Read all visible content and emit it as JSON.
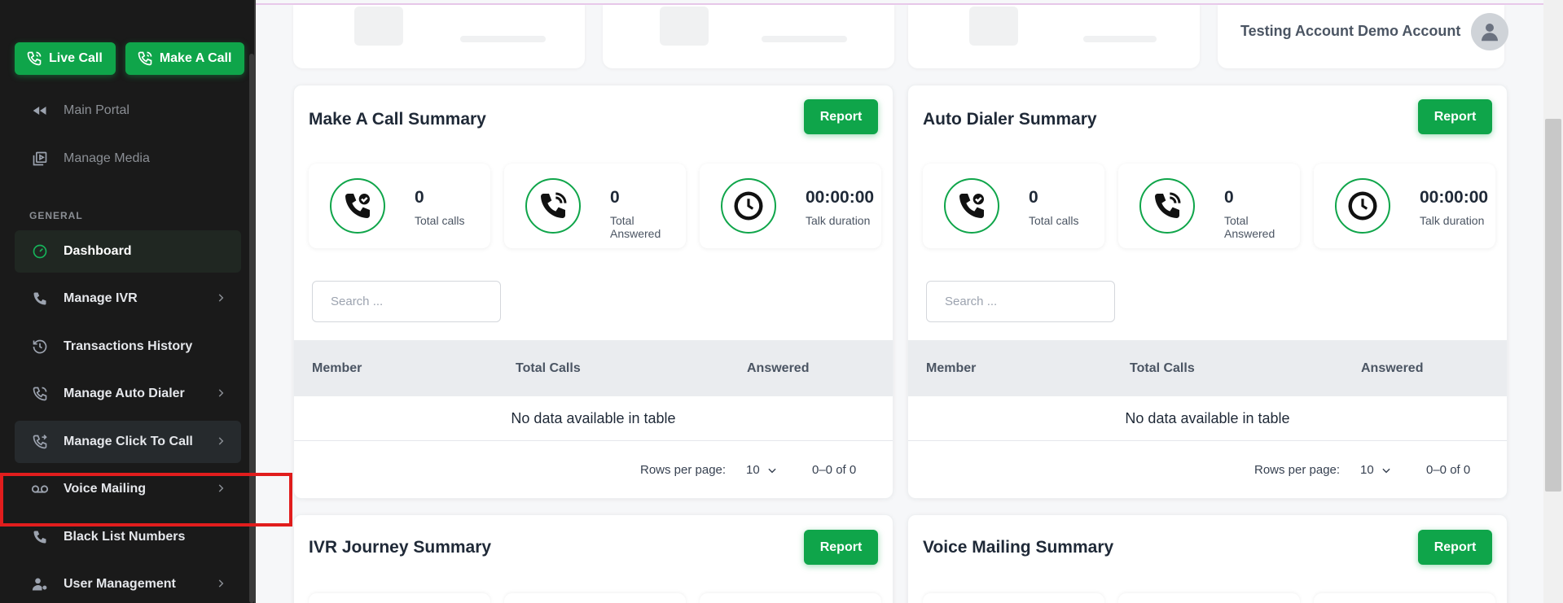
{
  "sidebar": {
    "live_call": "Live Call",
    "make_call": "Make A Call",
    "items_top": [
      {
        "label": "Main Portal",
        "icon": "rewind-icon"
      },
      {
        "label": "Manage Media",
        "icon": "media-icon"
      }
    ],
    "section_general": "GENERAL",
    "items": [
      {
        "label": "Dashboard",
        "icon": "gauge-icon"
      },
      {
        "label": "Manage IVR",
        "icon": "phone-icon"
      },
      {
        "label": "Transactions History",
        "icon": "history-icon"
      },
      {
        "label": "Manage Auto Dialer",
        "icon": "phone-dial-icon"
      },
      {
        "label": "Manage Click To Call",
        "icon": "phone-forward-icon"
      },
      {
        "label": "Voice Mailing",
        "icon": "voicemail-icon"
      },
      {
        "label": "Black List Numbers",
        "icon": "phone-icon"
      },
      {
        "label": "User Management",
        "icon": "user-cog-icon"
      }
    ]
  },
  "header": {
    "user_name": "Testing Account Demo Account"
  },
  "panels": {
    "make_call": {
      "title": "Make A Call Summary",
      "report": "Report",
      "stats": [
        {
          "value": "0",
          "label": "Total calls"
        },
        {
          "value": "0",
          "label": "Total Answered"
        },
        {
          "value": "00:00:00",
          "label": "Talk duration"
        }
      ],
      "search_placeholder": "Search ...",
      "columns": [
        "Member",
        "Total Calls",
        "Answered"
      ],
      "empty": "No data available in table",
      "rows_per_page_label": "Rows per page:",
      "rows_per_page": "10",
      "range": "0–0 of 0"
    },
    "auto_dialer": {
      "title": "Auto Dialer Summary",
      "report": "Report",
      "stats": [
        {
          "value": "0",
          "label": "Total calls"
        },
        {
          "value": "0",
          "label": "Total Answered"
        },
        {
          "value": "00:00:00",
          "label": "Talk duration"
        }
      ],
      "search_placeholder": "Search ...",
      "columns": [
        "Member",
        "Total Calls",
        "Answered"
      ],
      "empty": "No data available in table",
      "rows_per_page_label": "Rows per page:",
      "rows_per_page": "10",
      "range": "0–0 of 0"
    },
    "ivr_journey": {
      "title": "IVR Journey Summary",
      "report": "Report"
    },
    "voice_mailing": {
      "title": "Voice Mailing Summary",
      "report": "Report"
    }
  },
  "colors": {
    "accent": "#0fa54a",
    "sidebar_bg": "#1a1a1a",
    "highlight": "#e11d1d"
  }
}
